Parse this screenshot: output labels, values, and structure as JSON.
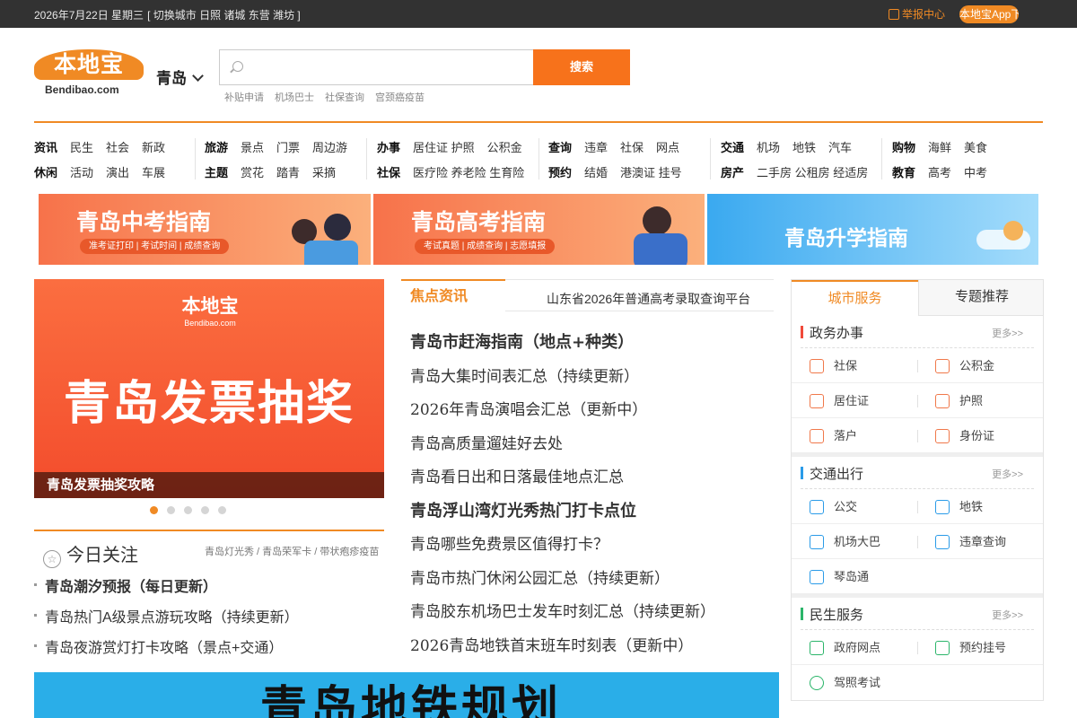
{
  "topbar": {
    "date": "2026年7月22日 星期三",
    "switch_city": "[ 切换城市 日照 诸城 东营 潍坊 ]",
    "report": "举报中心",
    "app_download": "本地宝App下载"
  },
  "logo": {
    "cn": "本地宝",
    "en": "Bendibao.com"
  },
  "city": "青岛",
  "search": {
    "placeholder": "",
    "button": "搜索",
    "hot": [
      "补贴申请",
      "机场巴士",
      "社保查询",
      "宫颈癌疫苗"
    ]
  },
  "nav": {
    "col1": {
      "r1": [
        "资讯",
        "民生",
        "社会",
        "新政"
      ],
      "r2": [
        "休闲",
        "活动",
        "演出",
        "车展"
      ]
    },
    "col2": {
      "r1": [
        "旅游",
        "景点",
        "门票",
        "周边游"
      ],
      "r2": [
        "主题",
        "赏花",
        "踏青",
        "采摘"
      ]
    },
    "col3": {
      "r1": [
        "办事",
        "居住证 护照",
        "公积金"
      ],
      "r2": [
        "社保",
        "医疗险 养老险 生育险"
      ]
    },
    "col4": {
      "r1": [
        "查询",
        "违章",
        "社保",
        "网点"
      ],
      "r2": [
        "预约",
        "结婚",
        "港澳证 挂号"
      ]
    },
    "col5": {
      "r1": [
        "交通",
        "机场",
        "地铁",
        "汽车"
      ],
      "r2": [
        "房产",
        "二手房 公租房 经适房"
      ]
    },
    "col6": {
      "r1": [
        "购物",
        "海鲜",
        "美食"
      ],
      "r2": [
        "教育",
        "高考",
        "中考"
      ]
    }
  },
  "banners": [
    {
      "title": "青岛中考指南",
      "sub": "准考证打印 | 考试时间 | 成绩查询"
    },
    {
      "title": "青岛高考指南",
      "sub": "考试真题 | 成绩查询 | 志愿填报"
    },
    {
      "title": "青岛升学指南"
    }
  ],
  "slider": {
    "logo_cn": "本地宝",
    "logo_en": "Bendibao.com",
    "title": "青岛发票抽奖",
    "caption": "青岛发票抽奖攻略",
    "dots": 5,
    "active": 0
  },
  "today": {
    "title": "今日关注",
    "links": "青岛灯光秀 / 青岛荣军卡 / 带状疱疹疫苗",
    "items": [
      "青岛潮汐预报（每日更新）",
      "青岛热门A级景点游玩攻略（持续更新）",
      "青岛夜游赏灯打卡攻略（景点+交通）"
    ]
  },
  "focus": {
    "tab": "焦点资讯",
    "marquee": "山东省2026年普通高考录取查询平台",
    "items": [
      "青岛市赶海指南（地点+种类）",
      "青岛大集时间表汇总（持续更新）",
      "2026年青岛演唱会汇总（更新中）",
      "青岛高质量遛娃好去处",
      "青岛看日出和日落最佳地点汇总",
      "青岛浮山湾灯光秀热门打卡点位",
      "青岛哪些免费景区值得打卡？",
      "青岛市热门休闲公园汇总（持续更新）",
      "青岛胶东机场巴士发车时刻汇总（持续更新）",
      "2026青岛地铁首末班车时刻表（更新中）"
    ]
  },
  "services": {
    "tab_active": "城市服务",
    "tab_other": "专题推荐",
    "more": "更多>>",
    "groups": [
      {
        "title": "政务办事",
        "items": [
          "社保",
          "公积金",
          "居住证",
          "护照",
          "落户",
          "身份证"
        ]
      },
      {
        "title": "交通出行",
        "items": [
          "公交",
          "地铁",
          "机场大巴",
          "违章查询",
          "琴岛通"
        ]
      },
      {
        "title": "民生服务",
        "items": [
          "政府网点",
          "预约挂号",
          "驾照考试"
        ]
      }
    ]
  },
  "subway_banner": {
    "title": "青岛地铁规划"
  },
  "colors": {
    "accent": "#f08a24",
    "topbar": "#323232",
    "button": "#f7721b"
  }
}
